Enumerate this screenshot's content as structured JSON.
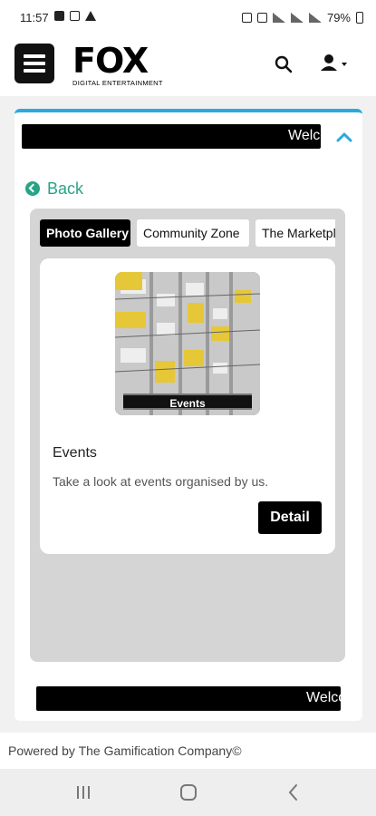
{
  "status_bar": {
    "time": "11:57",
    "battery": "79%",
    "notification_icons": [
      "image-icon",
      "linkedin-icon",
      "warning-icon"
    ],
    "system_icons": [
      "alarm-icon",
      "mute-icon",
      "wifi-icon",
      "signal-icon",
      "signal-icon"
    ]
  },
  "header": {
    "logo_text": "FOX",
    "logo_subtitle": "DIGITAL ENTERTAINMENT"
  },
  "announcement": {
    "text": "Welcome"
  },
  "navigation": {
    "back_label": "Back"
  },
  "tabs": [
    {
      "label": "Photo Gallery",
      "active": true
    },
    {
      "label": "Community Zone",
      "active": false
    },
    {
      "label": "The Marketplace",
      "active": false
    }
  ],
  "gallery_item": {
    "image_caption": "Events",
    "title": "Events",
    "description": "Take a look at events organised by us.",
    "button_label": "Detail"
  },
  "footer": {
    "text": "Powered by The Gamification Company©"
  },
  "colors": {
    "accent_blue": "#29a9e0",
    "back_green": "#27a487",
    "black": "#000000",
    "panel_gray": "#d5d5d5"
  }
}
